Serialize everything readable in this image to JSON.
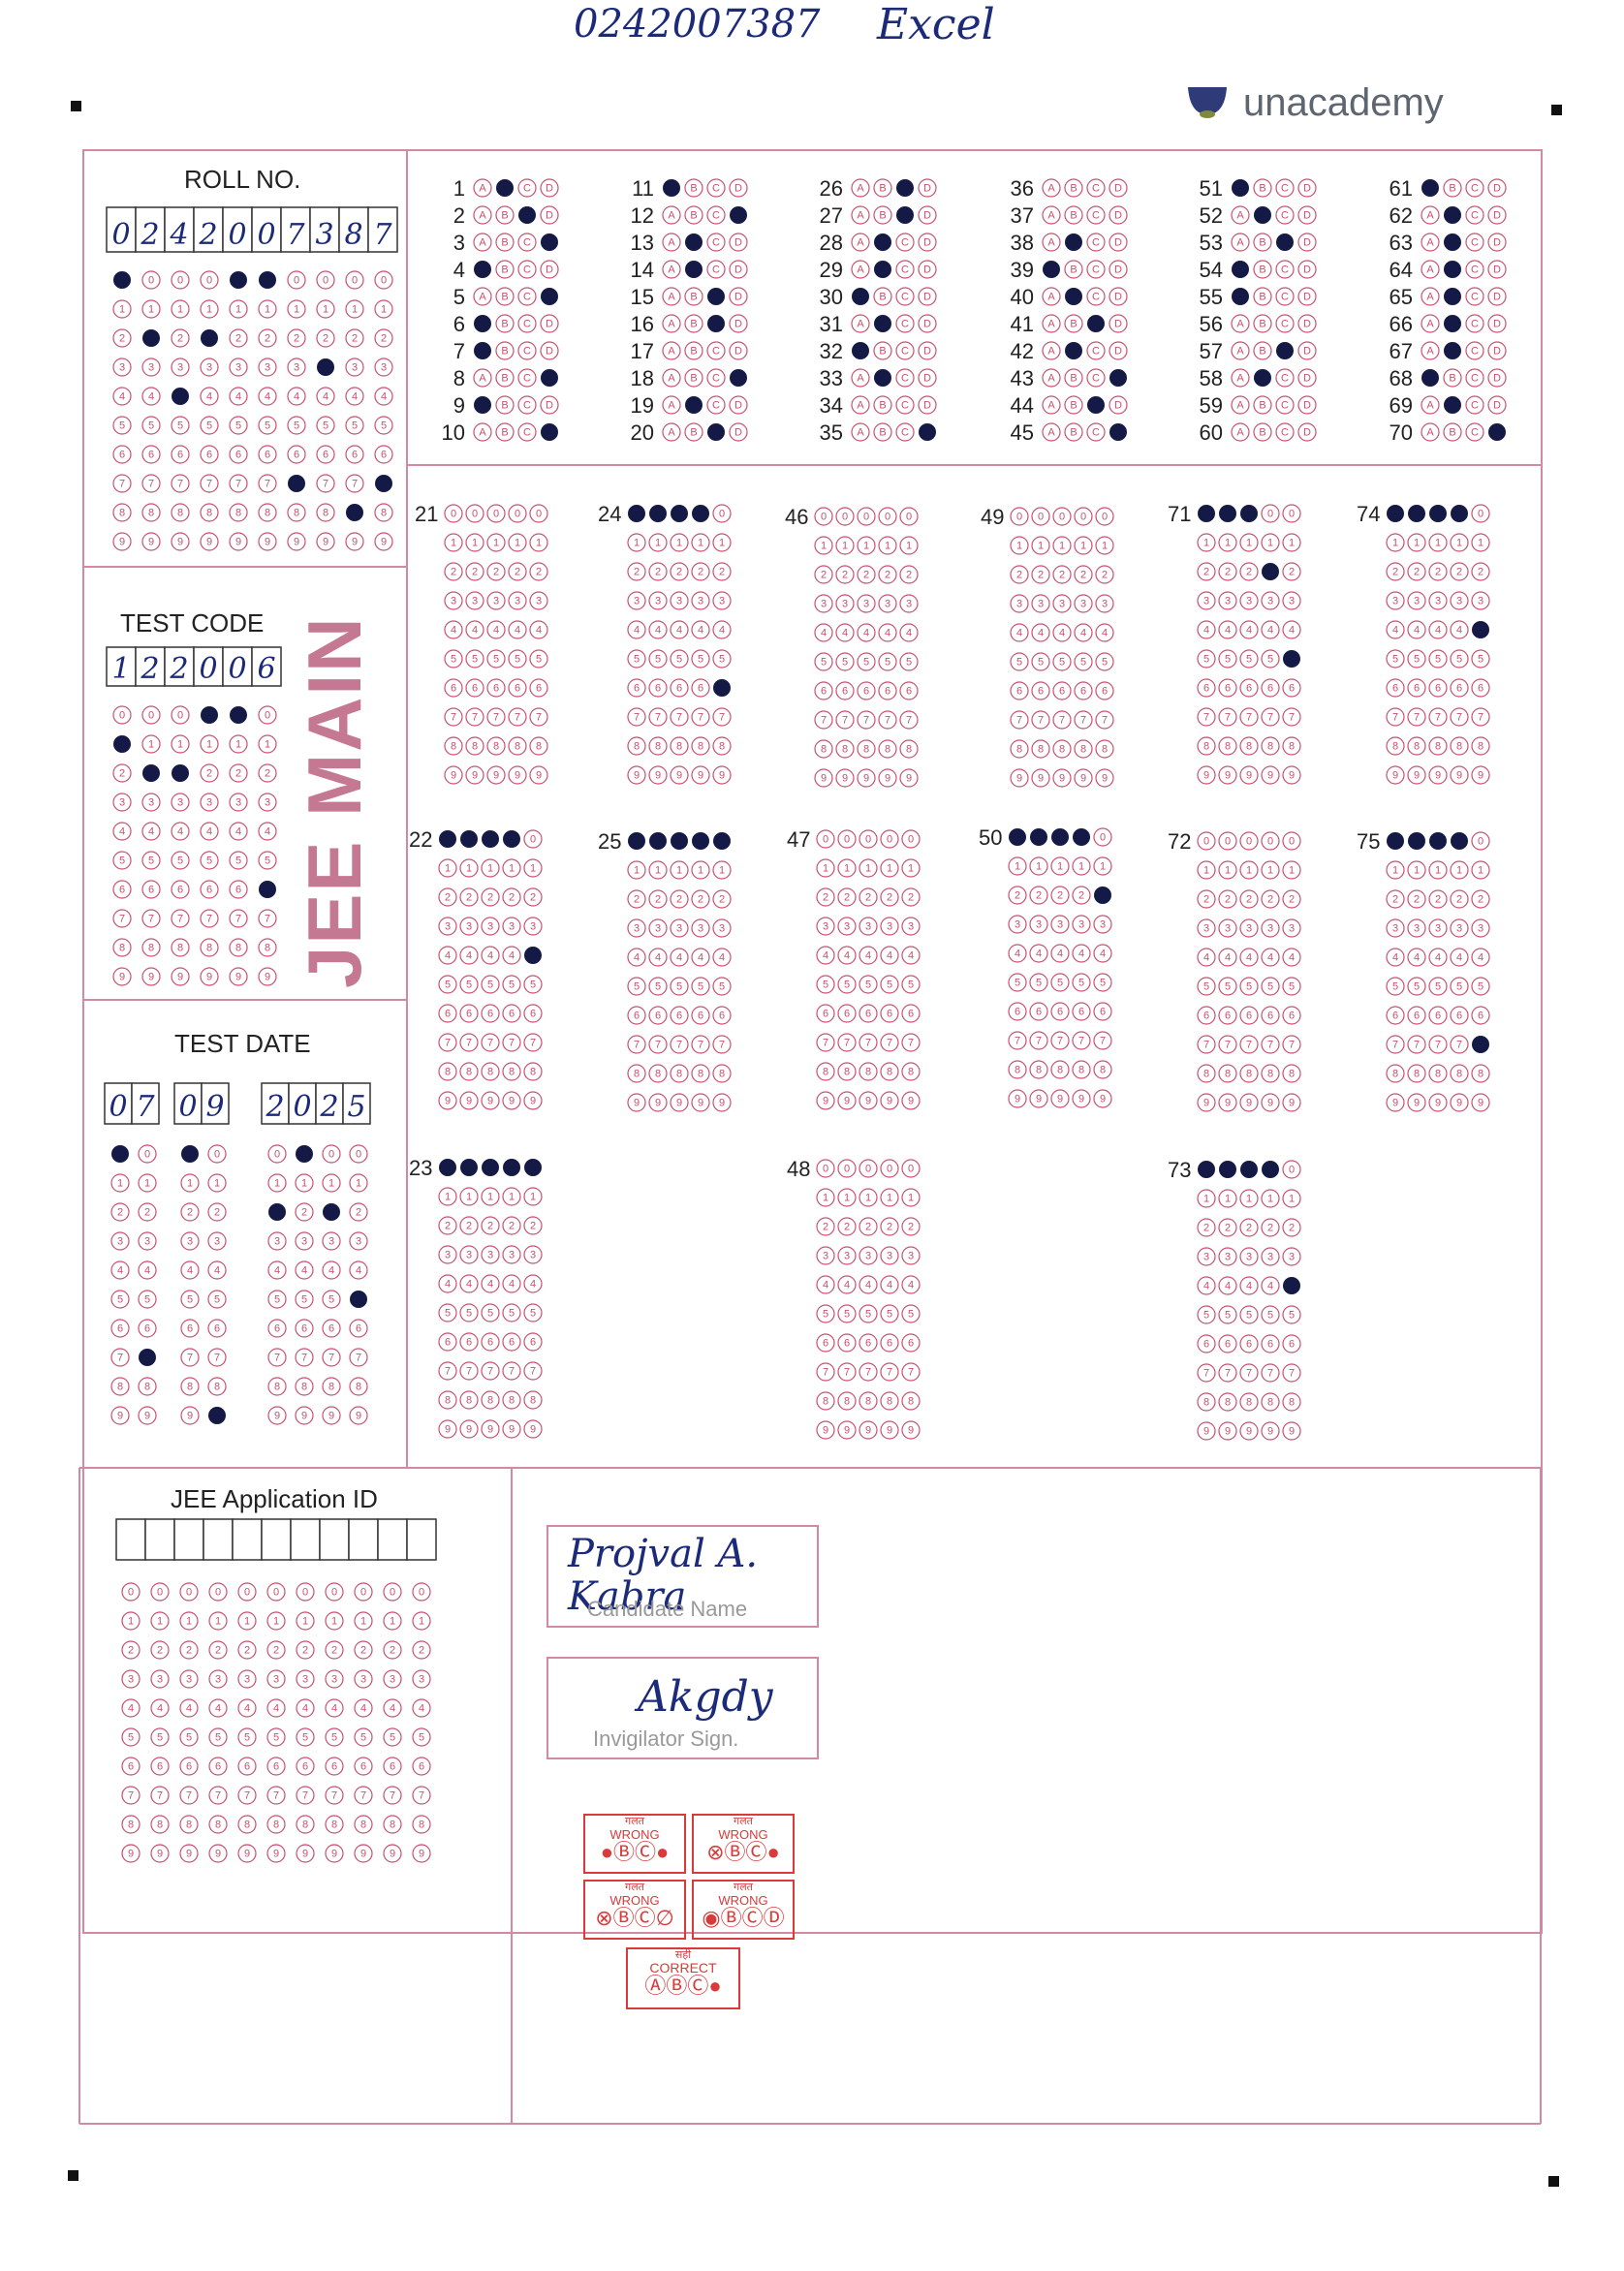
{
  "top_note": {
    "sheet_number": "0242007387",
    "tag": "Excel"
  },
  "brand": {
    "name": "unacademy",
    "color": "#5c6570",
    "logo_color": "#2f3a78"
  },
  "colors": {
    "accent": "#b33f63",
    "line": "#d28aa0",
    "ink": "#141a45"
  },
  "roll_no": {
    "title": "ROLL NO.",
    "digits": [
      "0",
      "2",
      "4",
      "2",
      "0",
      "0",
      "7",
      "3",
      "8",
      "7"
    ]
  },
  "test_code": {
    "title": "TEST CODE",
    "digits": [
      "1",
      "2",
      "2",
      "0",
      "0",
      "6"
    ]
  },
  "exam_name": "JEE MAIN",
  "test_date": {
    "title": "TEST DATE",
    "day": [
      "0",
      "7"
    ],
    "month": [
      "0",
      "9"
    ],
    "year": [
      "2",
      "0",
      "2",
      "5"
    ]
  },
  "application_id": {
    "title": "JEE Application ID",
    "digits": [
      "",
      "",
      "",
      "",
      "",
      "",
      "",
      "",
      "",
      "",
      ""
    ]
  },
  "options": [
    "A",
    "B",
    "C",
    "D"
  ],
  "mcq_answers": {
    "1": "B",
    "2": "C",
    "3": "D",
    "4": "A",
    "5": "D",
    "6": "A",
    "7": "A",
    "8": "D",
    "9": "A",
    "10": "D",
    "11": "A",
    "12": "D",
    "13": "B",
    "14": "B",
    "15": "C",
    "16": "C",
    "17": "",
    "18": "D",
    "19": "B",
    "20": "C",
    "26": "C",
    "27": "C",
    "28": "B",
    "29": "B",
    "30": "A",
    "31": "B",
    "32": "A",
    "33": "B",
    "34": "",
    "35": "D",
    "36": "",
    "37": "",
    "38": "B",
    "39": "A",
    "40": "B",
    "41": "C",
    "42": "B",
    "43": "D",
    "44": "C",
    "45": "D",
    "51": "A",
    "52": "B",
    "53": "C",
    "54": "A",
    "55": "A",
    "56": "",
    "57": "C",
    "58": "B",
    "59": "",
    "60": "",
    "61": "A",
    "62": "B",
    "63": "B",
    "64": "B",
    "65": "B",
    "66": "B",
    "67": "B",
    "68": "A",
    "69": "B",
    "70": "D"
  },
  "numeric_answers": {
    "21": "",
    "22": "",
    "23": "",
    "24": "",
    "25": "",
    "46": "",
    "47": "",
    "48": "",
    "49": "",
    "50": "",
    "71": "",
    "72": "",
    "73": "",
    "74": "",
    "75": ""
  },
  "numeric_fills": {
    "24": [
      [
        0,
        0
      ],
      [
        1,
        0
      ],
      [
        2,
        0
      ],
      [
        3,
        0
      ],
      [
        4,
        6
      ]
    ],
    "22": [
      [
        0,
        0
      ],
      [
        1,
        0
      ],
      [
        2,
        0
      ],
      [
        3,
        0
      ],
      [
        4,
        4
      ]
    ],
    "25": [
      [
        0,
        0
      ],
      [
        1,
        0
      ],
      [
        2,
        0
      ],
      [
        3,
        0
      ],
      [
        4,
        0
      ]
    ],
    "23": [
      [
        0,
        0
      ],
      [
        1,
        0
      ],
      [
        2,
        0
      ],
      [
        3,
        0
      ],
      [
        4,
        0
      ]
    ],
    "50": [
      [
        0,
        0
      ],
      [
        1,
        0
      ],
      [
        2,
        0
      ],
      [
        3,
        0
      ],
      [
        4,
        2
      ]
    ],
    "71": [
      [
        0,
        0
      ],
      [
        1,
        0
      ],
      [
        2,
        0
      ],
      [
        3,
        2
      ],
      [
        4,
        5
      ]
    ],
    "74": [
      [
        0,
        0
      ],
      [
        1,
        0
      ],
      [
        2,
        0
      ],
      [
        3,
        0
      ],
      [
        4,
        4
      ]
    ],
    "75": [
      [
        0,
        0
      ],
      [
        1,
        0
      ],
      [
        2,
        0
      ],
      [
        3,
        0
      ],
      [
        4,
        7
      ]
    ],
    "73": [
      [
        0,
        0
      ],
      [
        1,
        0
      ],
      [
        2,
        0
      ],
      [
        3,
        0
      ],
      [
        4,
        4
      ]
    ]
  },
  "roll_fills": [
    0,
    2,
    4,
    2,
    0,
    0,
    7,
    3,
    8,
    7
  ],
  "code_fills": [
    1,
    2,
    2,
    0,
    0,
    6
  ],
  "date_fills": {
    "day": [
      0,
      7
    ],
    "month": [
      0,
      9
    ],
    "year": [
      2,
      0,
      2,
      5
    ]
  },
  "candidate": {
    "name_handwritten": "Projval A. Kabra",
    "name_caption": "Candidate Name",
    "invigilator_handwritten": "Akgdy",
    "invigilator_caption": "Invigilator Sign."
  },
  "legend": [
    {
      "hindi": "गलत",
      "label": "WRONG",
      "marks": "●ⒷⒸ●"
    },
    {
      "hindi": "गलत",
      "label": "WRONG",
      "marks": "⊗ⒷⒸ●"
    },
    {
      "hindi": "गलत",
      "label": "WRONG",
      "marks": "⊗ⒷⒸ∅"
    },
    {
      "hindi": "गलत",
      "label": "WRONG",
      "marks": "◉ⒷⒸⒹ"
    },
    {
      "hindi": "सही",
      "label": "CORRECT",
      "marks": "ⒶⒷⒸ●"
    }
  ]
}
